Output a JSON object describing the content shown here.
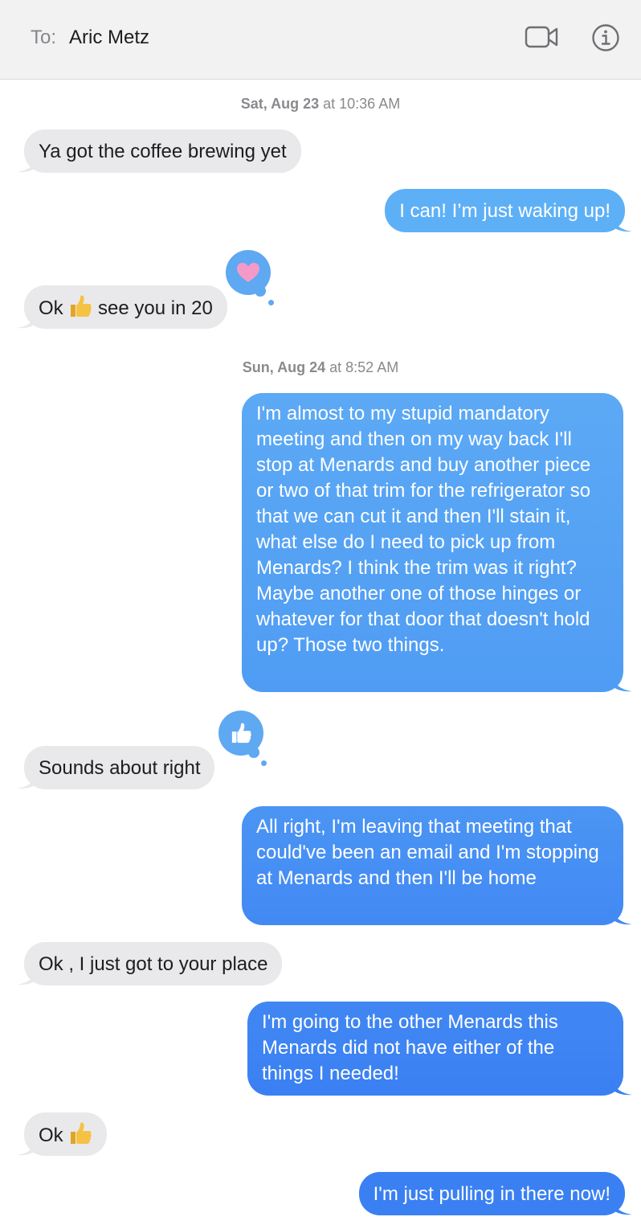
{
  "header": {
    "to_label": "To:",
    "recipient": "Aric Metz",
    "video_icon": "video-camera-icon",
    "info_icon": "info-icon"
  },
  "timestamps": [
    {
      "day": "Sat, Aug 23",
      "time": "at 10:36 AM"
    },
    {
      "day": "Sun, Aug 24",
      "time": "at 8:52 AM"
    }
  ],
  "messages": [
    {
      "dir": "in",
      "text": "Ya got the coffee brewing yet"
    },
    {
      "dir": "out",
      "text": "I can! I’m just waking up!"
    },
    {
      "dir": "in",
      "text_before": "Ok",
      "text_after": "see you in 20",
      "emoji": "thumbs-up",
      "tapback": "heart"
    },
    {
      "dir": "out",
      "text": "I'm almost to my stupid mandatory meeting and then on my way back I'll stop at Menards and buy another piece or two of that trim for the refrigerator so that we can cut it and then I'll stain it, what else do I need to pick up from Menards? I think the trim was it right? Maybe another one of those hinges or whatever for that door that doesn't hold up? Those two things."
    },
    {
      "dir": "in",
      "text": "Sounds about right",
      "tapback": "thumbs-up"
    },
    {
      "dir": "out",
      "text": "All right, I'm leaving that meeting that could've been an email and I'm stopping at Menards and then I'll be home"
    },
    {
      "dir": "in",
      "text": "Ok , I just got to your place"
    },
    {
      "dir": "out",
      "text": "I'm going to the other Menards this Menards did not have either of the things I needed!"
    },
    {
      "dir": "in",
      "text_before": "Ok",
      "emoji": "thumbs-up"
    },
    {
      "dir": "out",
      "text": "I'm just pulling in there now!"
    }
  ],
  "colors": {
    "incoming_bubble": "#e9e9eb",
    "outgoing_light": "#5eb0f6",
    "outgoing_dark": "#3a80f3",
    "tapback": "#5fa8f2"
  }
}
